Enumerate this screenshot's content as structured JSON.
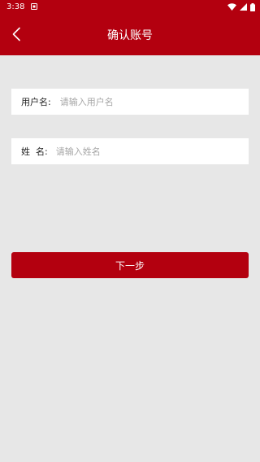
{
  "status_bar": {
    "time": "3:38",
    "icons": [
      "notification-icon",
      "wifi-icon",
      "signal-icon",
      "battery-icon"
    ]
  },
  "app_bar": {
    "title": "确认账号",
    "back_icon": "chevron-left-icon"
  },
  "form": {
    "username": {
      "label": "用户名:",
      "placeholder": "请输入用户名",
      "value": ""
    },
    "name": {
      "label": "姓  名:",
      "placeholder": "请输入姓名",
      "value": ""
    }
  },
  "actions": {
    "next_label": "下一步"
  },
  "colors": {
    "primary": "#b3000f",
    "background": "#e7e7e7",
    "field_background": "#ffffff",
    "placeholder": "#a6a6a6"
  }
}
